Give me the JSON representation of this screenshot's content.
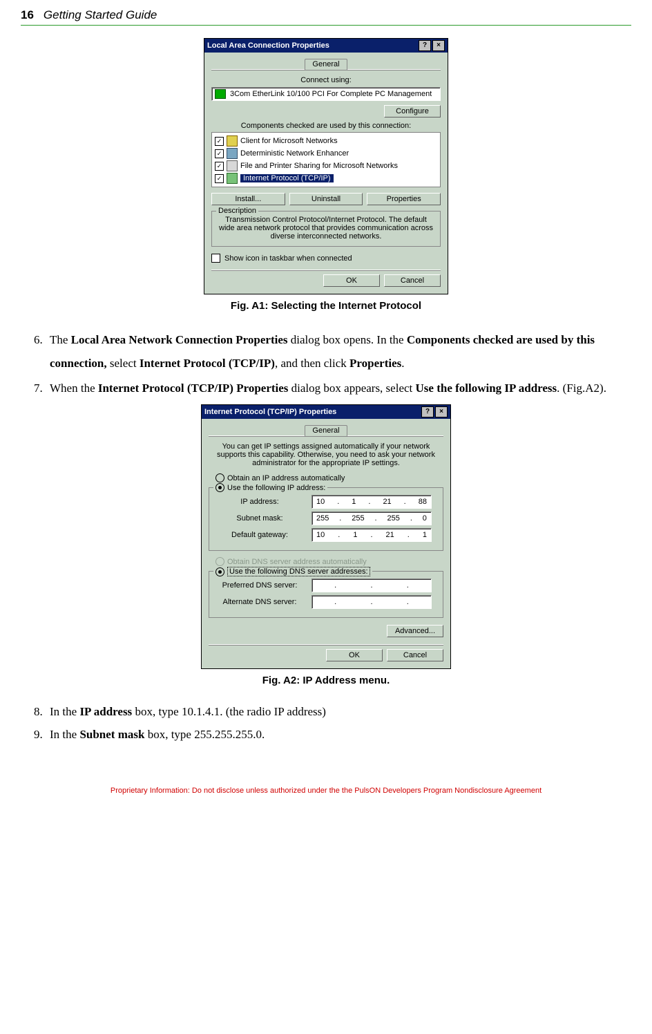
{
  "header": {
    "page_num": "16",
    "title": "Getting Started Guide"
  },
  "dialog1": {
    "title": "Local Area Connection Properties",
    "help_btn": "?",
    "close_btn": "×",
    "tab": "General",
    "connect_using_label": "Connect using:",
    "nic": "3Com EtherLink 10/100 PCI For Complete PC Management",
    "configure": "Configure",
    "components_label": "Components checked are used by this connection:",
    "items": [
      "Client for Microsoft Networks",
      "Deterministic Network Enhancer",
      "File and Printer Sharing for Microsoft Networks",
      "Internet Protocol (TCP/IP)"
    ],
    "install": "Install...",
    "uninstall": "Uninstall",
    "properties": "Properties",
    "desc_legend": "Description",
    "desc_text": "Transmission Control Protocol/Internet Protocol. The default wide area network protocol that provides communication across diverse interconnected networks.",
    "show_icon": "Show icon in taskbar when connected",
    "ok": "OK",
    "cancel": "Cancel"
  },
  "fig1_caption": "Fig. A1:   Selecting the Internet Protocol",
  "steps": {
    "s6_a": "The ",
    "s6_b": "Local Area Network Connection Properties",
    "s6_c": " dialog box opens. In the ",
    "s6_d": "Components checked are used by this connection,",
    "s6_e": " select ",
    "s6_f": "Internet Protocol (TCP/IP)",
    "s6_g": ", and then click ",
    "s6_h": "Properties",
    "s6_i": ".",
    "s7_a": "When the ",
    "s7_b": "Internet Protocol (TCP/IP) Properties",
    "s7_c": " dialog box appears, select ",
    "s7_d": "Use the following IP address",
    "s7_e": ". (Fig.A2).",
    "s8_a": "In the ",
    "s8_b": "IP address",
    "s8_c": " box, type 10.1.4.1. (the radio IP address)",
    "s9_a": "In the ",
    "s9_b": "Subnet mask",
    "s9_c": " box, type 255.255.255.0."
  },
  "dialog2": {
    "title": "Internet Protocol (TCP/IP) Properties",
    "help_btn": "?",
    "close_btn": "×",
    "tab": "General",
    "intro": "You can get IP settings assigned automatically if your network supports this capability. Otherwise, you need to ask your network administrator for the appropriate IP settings.",
    "obtain_auto": "Obtain an IP address automatically",
    "use_following_ip": "Use the following IP address:",
    "ip_label": "IP address:",
    "subnet_label": "Subnet mask:",
    "gateway_label": "Default gateway:",
    "ip": [
      "10",
      "1",
      "21",
      "88"
    ],
    "subnet": [
      "255",
      "255",
      "255",
      "0"
    ],
    "gateway": [
      "10",
      "1",
      "21",
      "1"
    ],
    "obtain_dns_auto": "Obtain DNS server address automatically",
    "use_following_dns": "Use the following DNS server addresses:",
    "pref_dns_label": "Preferred DNS server:",
    "alt_dns_label": "Alternate DNS server:",
    "advanced": "Advanced...",
    "ok": "OK",
    "cancel": "Cancel"
  },
  "fig2_caption": "Fig. A2:  IP Address menu.",
  "footer": "Proprietary Information:  Do not disclose unless authorized under the the PulsON Developers Program Nondisclosure Agreement"
}
